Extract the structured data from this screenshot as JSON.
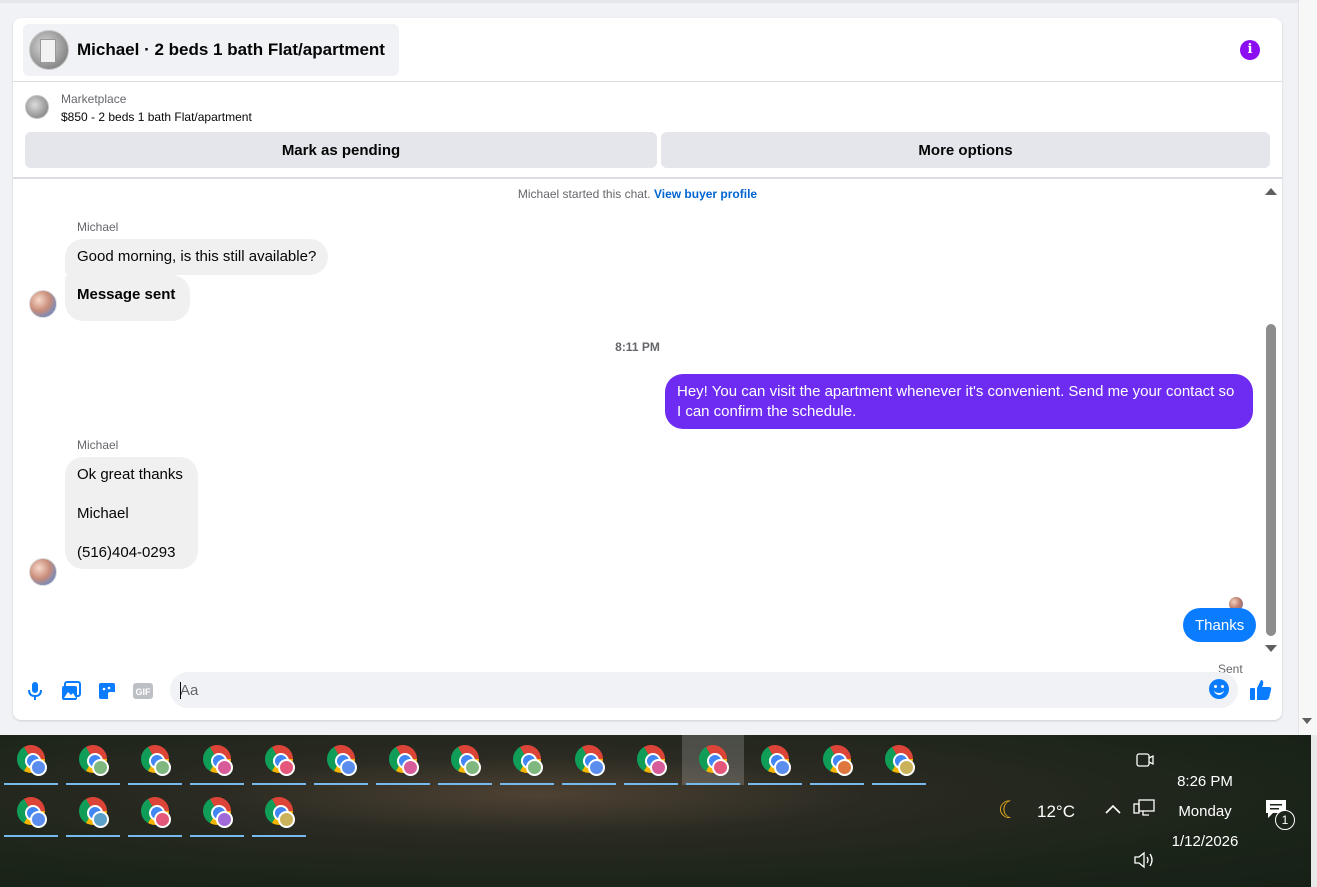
{
  "chat": {
    "title": "Michael · 2 beds 1 bath Flat/apartment",
    "listing": {
      "source": "Marketplace",
      "price_title": "$850 - 2 beds 1 bath Flat/apartment"
    },
    "actions": {
      "mark_pending": "Mark as pending",
      "more_options": "More options"
    },
    "started_text": "Michael started this chat.",
    "view_profile_link": "View buyer profile",
    "messages": [
      {
        "sender": "Michael",
        "text": "Good morning, is this still available?"
      },
      {
        "sender": "Michael",
        "text": "Message sent"
      },
      {
        "timestamp": "8:11 PM"
      },
      {
        "sender": "me",
        "text": "Hey! You can visit the apartment whenever it's convenient. Send me your contact so I can confirm the schedule."
      },
      {
        "sender": "Michael",
        "lines": [
          "Ok great thanks",
          "Michael",
          "(516)404-0293"
        ]
      },
      {
        "sender": "me",
        "text": "Thanks"
      }
    ],
    "sent_status": "Sent",
    "composer_placeholder": "Aa"
  },
  "composer_icons": [
    "microphone-icon",
    "image-icon",
    "sticker-icon",
    "gif-icon",
    "emoji-icon",
    "thumbs-up-icon"
  ],
  "taskbar": {
    "row1_badge_colors": [
      "#5b8def",
      "#7fb87f",
      "#7fb87f",
      "#d85c9a",
      "#e4577a",
      "#5b8def",
      "#d85c9a",
      "#7fb87f",
      "#7fb87f",
      "#5b8def",
      "#d85c9a",
      "#e4577a",
      "#5b8def",
      "#e0763f",
      "#c9b25a"
    ],
    "row2_badge_colors": [
      "#5b8def",
      "#5ba0c8",
      "#e4577a",
      "#a06ad8",
      "#c9b25a"
    ],
    "active_index": 11,
    "weather": {
      "temp": "12°C",
      "icon": "moon-icon"
    },
    "clock": {
      "time": "8:26 PM",
      "day": "Monday",
      "date": "1/12/2026"
    },
    "notification_count": "1"
  },
  "colors": {
    "accent_purple": "#6e2cf2",
    "accent_blue": "#0a7cff",
    "info_purple": "#8a0ef0",
    "link_blue": "#0064d1"
  }
}
